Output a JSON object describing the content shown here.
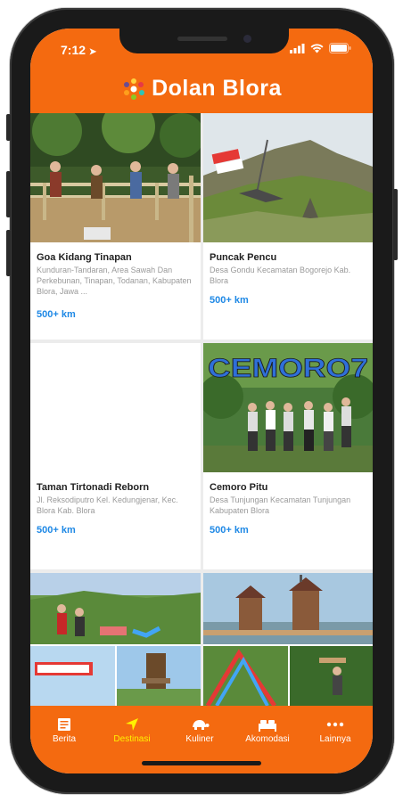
{
  "status": {
    "time": "7:12"
  },
  "app": {
    "brand": "Dolan Blora"
  },
  "cards": [
    {
      "title": "Goa Kidang Tinapan",
      "address": "Kunduran-Tandaran, Area Sawah Dan Perkebunan, Tinapan, Todanan, Kabupaten Blora, Jawa ...",
      "distance": "500+ km"
    },
    {
      "title": "Puncak Pencu",
      "address": "Desa Gondu Kecamatan Bogorejo Kab. Blora",
      "distance": "500+ km"
    },
    {
      "title": "Taman Tirtonadi Reborn",
      "address": "Jl. Reksodiputro Kel. Kedungjenar, Kec. Blora Kab. Blora",
      "distance": "500+ km"
    },
    {
      "title": "Cemoro Pitu",
      "address": "Desa Tunjungan Kecamatan Tunjungan Kabupaten Blora",
      "distance": "500+ km",
      "sign": "CEMORO7"
    },
    {
      "title": "",
      "address": "",
      "distance": ""
    },
    {
      "title": "",
      "address": "",
      "distance": ""
    }
  ],
  "nav": {
    "items": [
      {
        "label": "Berita",
        "icon": "newspaper-icon"
      },
      {
        "label": "Destinasi",
        "icon": "navigation-arrow-icon",
        "active": true
      },
      {
        "label": "Kuliner",
        "icon": "turtle-icon"
      },
      {
        "label": "Akomodasi",
        "icon": "bed-icon"
      },
      {
        "label": "Lainnya",
        "icon": "more-dots-icon"
      }
    ]
  },
  "colors": {
    "primary": "#f46a10",
    "active": "#fff200",
    "distance": "#1e88e5"
  }
}
